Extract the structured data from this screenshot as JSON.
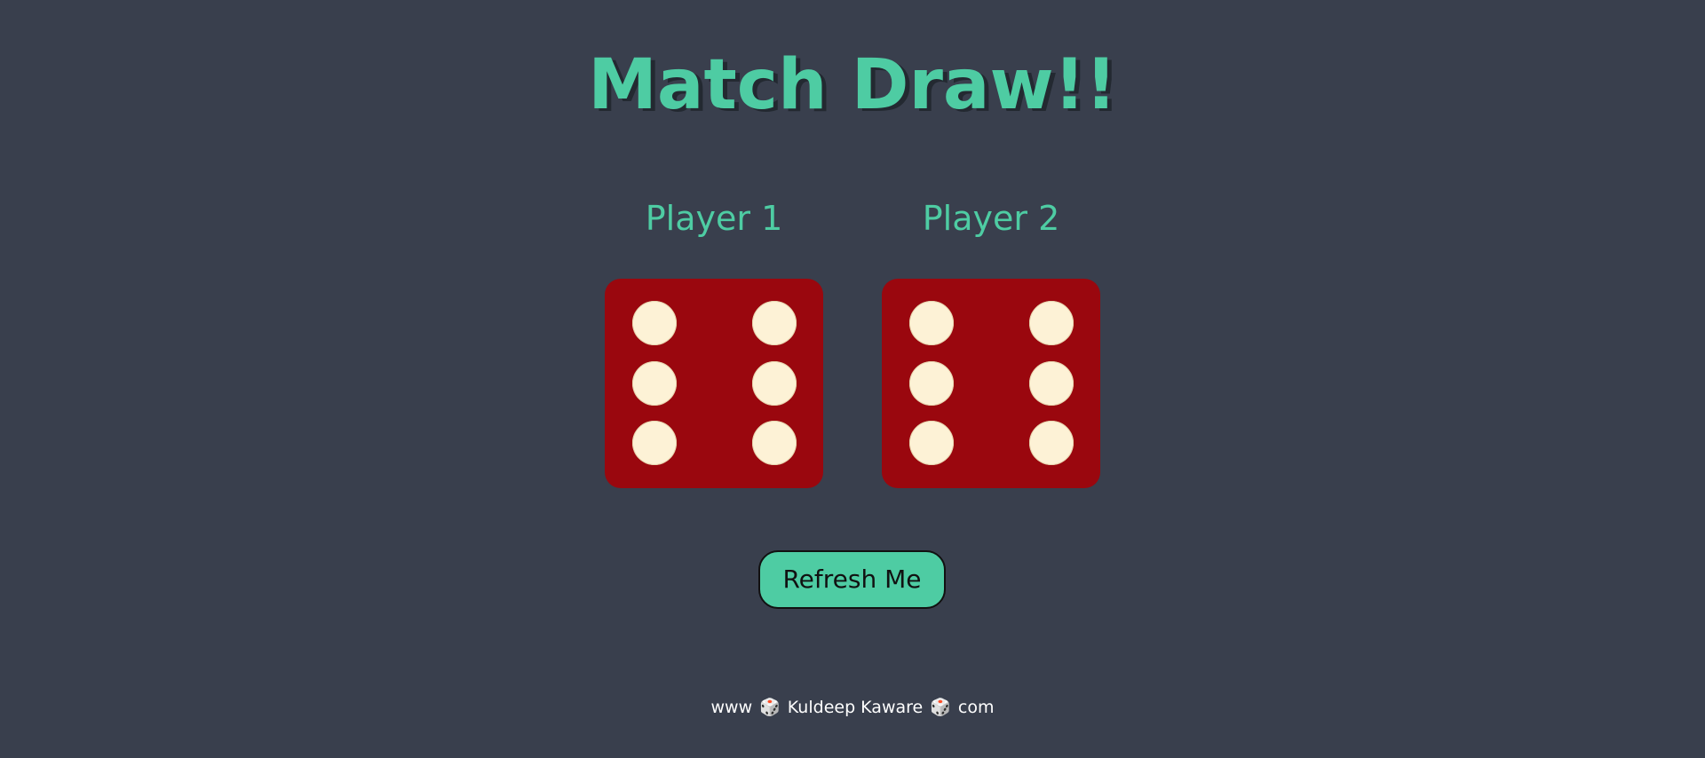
{
  "title": "Match Draw!!",
  "players": [
    {
      "label": "Player 1",
      "die_value": 6
    },
    {
      "label": "Player 2",
      "die_value": 6
    }
  ],
  "refresh_button": {
    "label": "Refresh Me"
  },
  "footer": {
    "prefix": "www",
    "icon_1": "🎲",
    "name": "Kuldeep Kaware",
    "icon_2": "🎲",
    "suffix": "com"
  },
  "colors": {
    "background": "#393f4d",
    "accent": "#4ecca3",
    "die": "#9a070e",
    "pip": "#fdf2d6"
  },
  "icons": {
    "footer_icon": "dice-icon"
  }
}
